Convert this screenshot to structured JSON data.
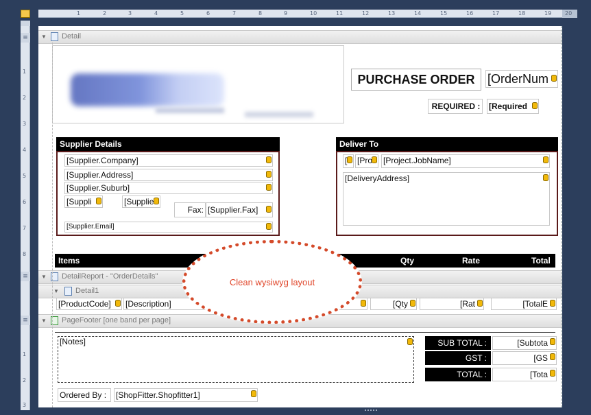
{
  "ruler": {
    "numbers": [
      "1",
      "2",
      "3",
      "4",
      "5",
      "6",
      "7",
      "8",
      "9",
      "10",
      "11",
      "12",
      "13",
      "14",
      "15",
      "16",
      "17",
      "18",
      "19",
      "20"
    ],
    "vnumbers": [
      "1",
      "2",
      "3",
      "4",
      "5",
      "6",
      "7",
      "8"
    ],
    "vnumbers_footer": [
      "1",
      "2",
      "3"
    ]
  },
  "bands": {
    "detail": "Detail",
    "detail_report": "DetailReport - \"OrderDetails\"",
    "detail1": "Detail1",
    "page_footer": "PageFooter [one band per page]"
  },
  "header": {
    "title": "PURCHASE ORDER",
    "order_num": "[OrderNum",
    "required_label": "REQUIRED :",
    "required_field": "[Required"
  },
  "supplier": {
    "title": "Supplier Details",
    "company": "[Supplier.Company]",
    "address": "[Supplier.Address]",
    "suburb": "[Supplier.Suburb]",
    "f1": "[Suppli",
    "f2": "[Supplie",
    "fax_label": "Fax:",
    "fax": "[Supplier.Fax]",
    "email": "[Supplier.Email]"
  },
  "deliver": {
    "title": "Deliver To",
    "f1": "[",
    "f2": "[Pro",
    "jobname": "[Project.JobName]",
    "address": "[DeliveryAddress]"
  },
  "items_header": {
    "items": "Items",
    "qty": "Qty",
    "rate": "Rate",
    "total": "Total"
  },
  "detail_row": {
    "product_code": "[ProductCode]",
    "description": "[Description]",
    "qty": "[Qty",
    "rate": "[Rat",
    "total": "[TotalE"
  },
  "footer": {
    "notes": "[Notes]",
    "sub_total_label": "SUB TOTAL :",
    "sub_total": "[Subtota",
    "gst_label": "GST :",
    "gst": "[GS",
    "total_label": "TOTAL :",
    "total": "[Tota",
    "ordered_by_label": "Ordered By :",
    "ordered_by": "[ShopFitter.Shopfitter1]"
  },
  "callout": "Clean wysiwyg layout",
  "icons": {
    "band_toggle": "collapse-triangle-icon",
    "field_db": "database-field-icon"
  }
}
